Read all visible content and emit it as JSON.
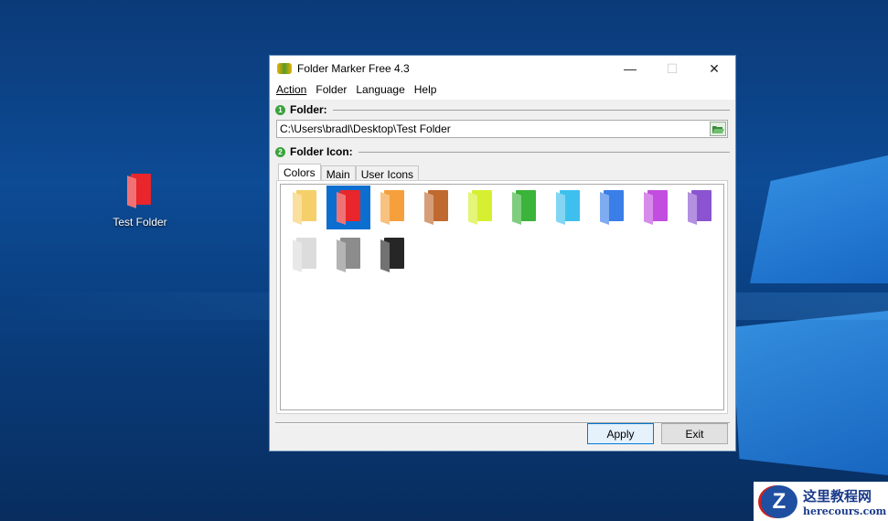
{
  "desktop": {
    "icon_label": "Test Folder",
    "icon_color": "#e8262b"
  },
  "window": {
    "title": "Folder Marker Free 4.3",
    "minimize": "—",
    "maximize": "☐",
    "close": "✕"
  },
  "menu": [
    {
      "label": "Action"
    },
    {
      "label": "Folder"
    },
    {
      "label": "Language"
    },
    {
      "label": "Help"
    }
  ],
  "section1": {
    "num": "1",
    "label": "Folder:"
  },
  "path": {
    "value": "C:\\Users\\bradl\\Desktop\\Test Folder"
  },
  "section2": {
    "num": "2",
    "label": "Folder Icon:"
  },
  "tabs": [
    {
      "label": "Colors",
      "active": true
    },
    {
      "label": "Main"
    },
    {
      "label": "User Icons"
    }
  ],
  "colors": [
    {
      "name": "yellow",
      "color": "#f5cf6a",
      "selected": false
    },
    {
      "name": "red",
      "color": "#e8262b",
      "selected": true
    },
    {
      "name": "orange",
      "color": "#f5a03c",
      "selected": false
    },
    {
      "name": "brown",
      "color": "#c06a30",
      "selected": false
    },
    {
      "name": "lime",
      "color": "#d6ef30",
      "selected": false
    },
    {
      "name": "green",
      "color": "#3ab43a",
      "selected": false
    },
    {
      "name": "sky-blue",
      "color": "#3ec0ee",
      "selected": false
    },
    {
      "name": "blue",
      "color": "#3a7ee8",
      "selected": false
    },
    {
      "name": "magenta",
      "color": "#c24ee0",
      "selected": false
    },
    {
      "name": "purple",
      "color": "#8a54d0",
      "selected": false
    },
    {
      "name": "white",
      "color": "#dcdcdc",
      "selected": false
    },
    {
      "name": "gray",
      "color": "#8c8c8c",
      "selected": false
    },
    {
      "name": "black",
      "color": "#262626",
      "selected": false
    }
  ],
  "buttons": {
    "apply": "Apply",
    "exit": "Exit"
  },
  "watermark": {
    "title": "这里教程网",
    "url": "herecours.com",
    "logo": "Z"
  }
}
